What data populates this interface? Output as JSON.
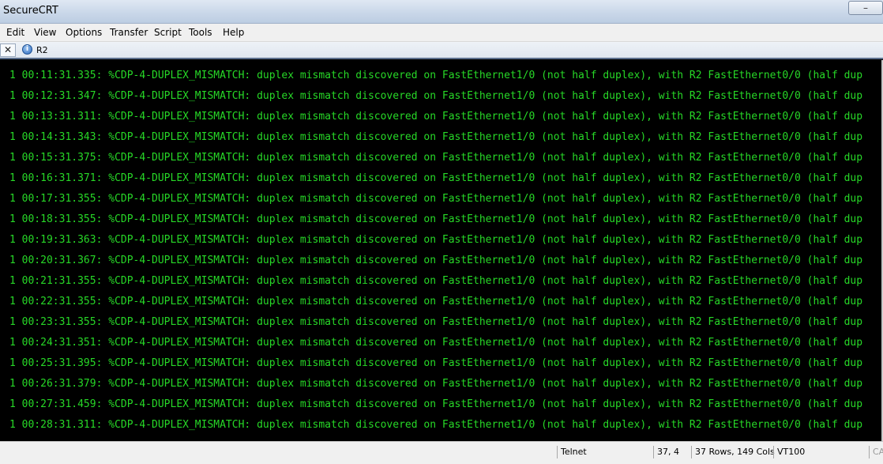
{
  "window": {
    "title": "SecureCRT",
    "minimize": "–",
    "maximize": "□",
    "close": "✕"
  },
  "menu": {
    "items": [
      "Edit",
      "View",
      "Options",
      "Transfer",
      "Script",
      "Tools",
      "Help"
    ]
  },
  "tabs": {
    "close_glyph": "✕",
    "items": [
      {
        "label": "R2",
        "icon": "session-info-icon"
      }
    ]
  },
  "terminal": {
    "lines": [
      "1 00:11:31.335: %CDP-4-DUPLEX_MISMATCH: duplex mismatch discovered on FastEthernet1/0 (not half duplex), with R2 FastEthernet0/0 (half dup",
      "1 00:12:31.347: %CDP-4-DUPLEX_MISMATCH: duplex mismatch discovered on FastEthernet1/0 (not half duplex), with R2 FastEthernet0/0 (half dup",
      "1 00:13:31.311: %CDP-4-DUPLEX_MISMATCH: duplex mismatch discovered on FastEthernet1/0 (not half duplex), with R2 FastEthernet0/0 (half dup",
      "1 00:14:31.343: %CDP-4-DUPLEX_MISMATCH: duplex mismatch discovered on FastEthernet1/0 (not half duplex), with R2 FastEthernet0/0 (half dup",
      "1 00:15:31.375: %CDP-4-DUPLEX_MISMATCH: duplex mismatch discovered on FastEthernet1/0 (not half duplex), with R2 FastEthernet0/0 (half dup",
      "1 00:16:31.371: %CDP-4-DUPLEX_MISMATCH: duplex mismatch discovered on FastEthernet1/0 (not half duplex), with R2 FastEthernet0/0 (half dup",
      "1 00:17:31.355: %CDP-4-DUPLEX_MISMATCH: duplex mismatch discovered on FastEthernet1/0 (not half duplex), with R2 FastEthernet0/0 (half dup",
      "1 00:18:31.355: %CDP-4-DUPLEX_MISMATCH: duplex mismatch discovered on FastEthernet1/0 (not half duplex), with R2 FastEthernet0/0 (half dup",
      "1 00:19:31.363: %CDP-4-DUPLEX_MISMATCH: duplex mismatch discovered on FastEthernet1/0 (not half duplex), with R2 FastEthernet0/0 (half dup",
      "1 00:20:31.367: %CDP-4-DUPLEX_MISMATCH: duplex mismatch discovered on FastEthernet1/0 (not half duplex), with R2 FastEthernet0/0 (half dup",
      "1 00:21:31.355: %CDP-4-DUPLEX_MISMATCH: duplex mismatch discovered on FastEthernet1/0 (not half duplex), with R2 FastEthernet0/0 (half dup",
      "1 00:22:31.355: %CDP-4-DUPLEX_MISMATCH: duplex mismatch discovered on FastEthernet1/0 (not half duplex), with R2 FastEthernet0/0 (half dup",
      "1 00:23:31.355: %CDP-4-DUPLEX_MISMATCH: duplex mismatch discovered on FastEthernet1/0 (not half duplex), with R2 FastEthernet0/0 (half dup",
      "1 00:24:31.351: %CDP-4-DUPLEX_MISMATCH: duplex mismatch discovered on FastEthernet1/0 (not half duplex), with R2 FastEthernet0/0 (half dup",
      "1 00:25:31.395: %CDP-4-DUPLEX_MISMATCH: duplex mismatch discovered on FastEthernet1/0 (not half duplex), with R2 FastEthernet0/0 (half dup",
      "1 00:26:31.379: %CDP-4-DUPLEX_MISMATCH: duplex mismatch discovered on FastEthernet1/0 (not half duplex), with R2 FastEthernet0/0 (half dup",
      "1 00:27:31.459: %CDP-4-DUPLEX_MISMATCH: duplex mismatch discovered on FastEthernet1/0 (not half duplex), with R2 FastEthernet0/0 (half dup",
      "1 00:28:31.311: %CDP-4-DUPLEX_MISMATCH: duplex mismatch discovered on FastEthernet1/0 (not half duplex), with R2 FastEthernet0/0 (half dup"
    ],
    "text_color": "#27d827",
    "background": "#000000"
  },
  "statusbar": {
    "protocol": "Telnet",
    "cursor": "37,  4",
    "size": "37 Rows, 149 Cols",
    "emulation": "VT100",
    "caps": "CA"
  }
}
